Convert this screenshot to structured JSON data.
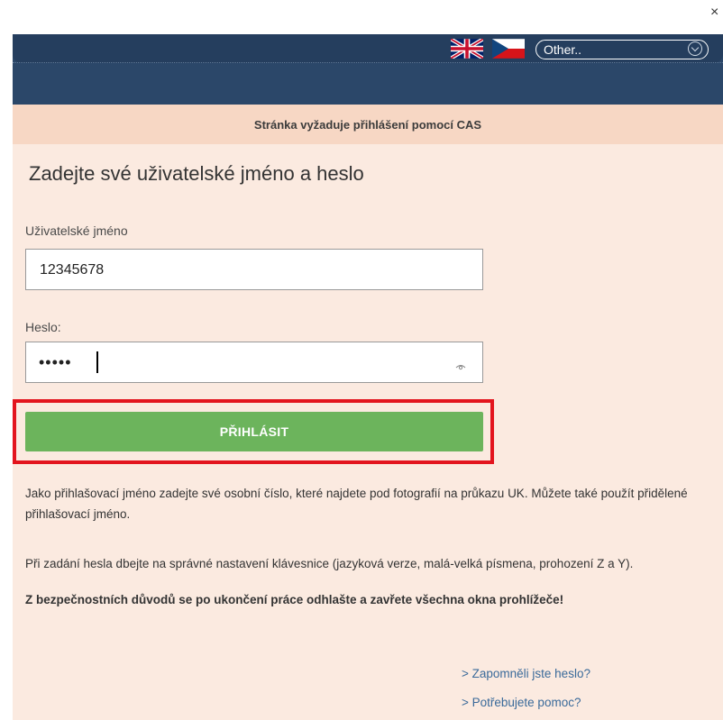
{
  "window": {
    "close_glyph": "×"
  },
  "header": {
    "flags": [
      {
        "name": "uk-flag-icon",
        "language": "English"
      },
      {
        "name": "cz-flag-icon",
        "language": "Čeština"
      }
    ],
    "language_select": {
      "selected": "Other.."
    },
    "colors": {
      "header_bg": "#2b4769",
      "panel_bg": "#fbeae0",
      "banner_bg": "#f7d7c4",
      "button_bg": "#6cb45c",
      "highlight": "#e3151e"
    }
  },
  "banner": {
    "text": "Stránka vyžaduje přihlášení pomocí CAS"
  },
  "form": {
    "title": "Zadejte své uživatelské jméno a heslo",
    "username": {
      "label": "Uživatelské jméno",
      "value": "12345678"
    },
    "password": {
      "label": "Heslo:",
      "masked_value": "•••••",
      "icon": "eye-icon"
    },
    "submit_label": "PŘIHLÁSIT"
  },
  "info": {
    "paragraph_1": "Jako přihlašovací jméno zadejte své osobní číslo, které najdete pod fotografií na průkazu UK. Můžete také použít přidělené přihlašovací jméno.",
    "paragraph_2": "Při zadání hesla dbejte na správné nastavení klávesnice (jazyková verze, malá-velká písmena, prohození Z a Y).",
    "warning": "Z bezpečnostních důvodů se po ukončení práce odhlašte a zavřete všechna okna prohlížeče!"
  },
  "links": {
    "forgot_password": "> Zapomněli jste heslo?",
    "need_help": "> Potřebujete pomoc?"
  }
}
